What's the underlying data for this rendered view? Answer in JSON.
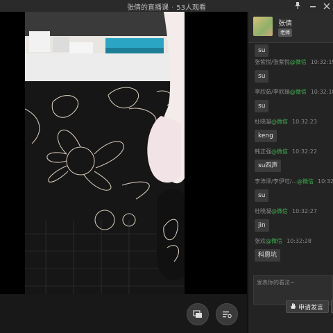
{
  "window": {
    "title": "张倩的直播课",
    "separator": "·",
    "viewers": "53人观看"
  },
  "teacher": {
    "name": "张倩",
    "role_badge": "老师"
  },
  "chat": {
    "messages": [
      {
        "user": "",
        "source": "",
        "time": "",
        "text": "su"
      },
      {
        "user": "张紫悦/张紫悦",
        "source": "@微信",
        "time": "10:32:19",
        "text": "su"
      },
      {
        "user": "李欣茹/李欣瑞",
        "source": "@微信",
        "time": "10:32:18",
        "text": "su"
      },
      {
        "user": "杜晓凝",
        "source": "@微信",
        "time": "10:32:23",
        "text": "keng"
      },
      {
        "user": "韩正强",
        "source": "@微信",
        "time": "10:32:22",
        "text": "su四声"
      },
      {
        "user": "李沛泽/李伊可/...",
        "source": "@微信",
        "time": "10:32",
        "text": "su"
      },
      {
        "user": "杜晓凝",
        "source": "@微信",
        "time": "10:32:27",
        "text": "jin"
      },
      {
        "user": "张欢",
        "source": "@微信",
        "time": "10:32:28",
        "text": "科恩坑"
      }
    ],
    "input_placeholder": "发表你的看法~",
    "apply_label": "申请发言"
  },
  "icons": {
    "pin": "pin-icon",
    "minimize": "minimize-icon",
    "close": "close-icon",
    "screen": "screen-switch-icon",
    "settings": "settings-list-icon",
    "hand": "hand-raise-icon"
  },
  "colors": {
    "wechat_green": "#3fae4b",
    "panel_bg": "#232323",
    "video_bg": "#000000"
  }
}
